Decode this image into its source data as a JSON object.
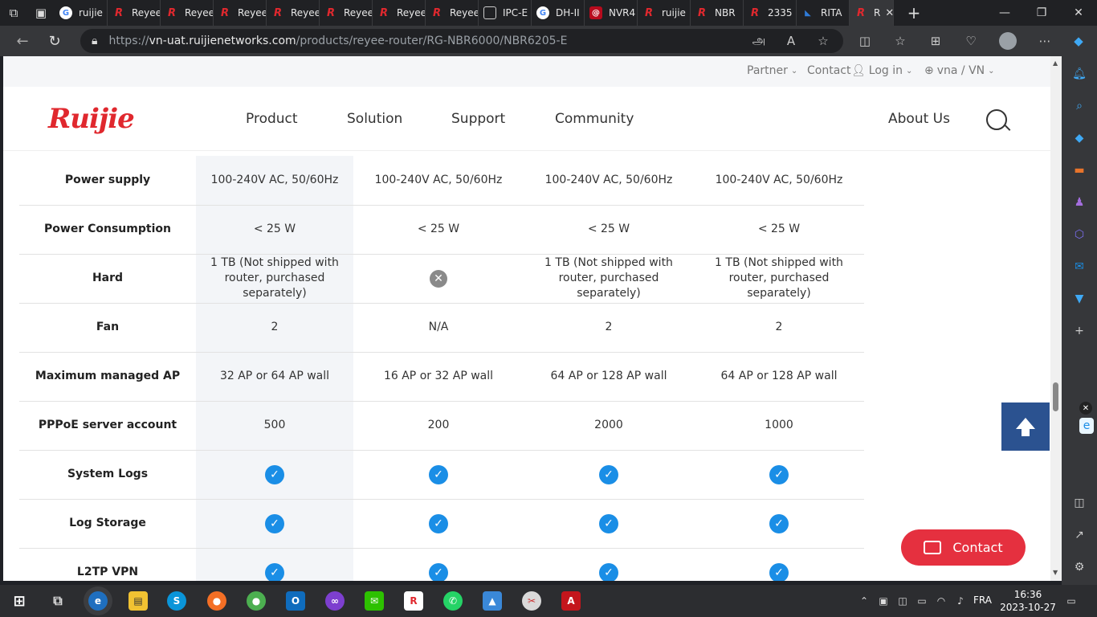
{
  "browser": {
    "tabs": [
      {
        "label": "ruijie",
        "fav": "G"
      },
      {
        "label": "Reyee",
        "fav": "R"
      },
      {
        "label": "Reyee",
        "fav": "R"
      },
      {
        "label": "Reyee",
        "fav": "R"
      },
      {
        "label": "Reyee",
        "fav": "R"
      },
      {
        "label": "Reyee",
        "fav": "R"
      },
      {
        "label": "Reyee",
        "fav": "R"
      },
      {
        "label": "Reyee",
        "fav": "R"
      },
      {
        "label": "IPC-E",
        "fav": "D"
      },
      {
        "label": "DH-II",
        "fav": "G"
      },
      {
        "label": "NVR4",
        "fav": "N"
      },
      {
        "label": "ruijie",
        "fav": "R"
      },
      {
        "label": "NBR",
        "fav": "R"
      },
      {
        "label": "2335",
        "fav": "R"
      },
      {
        "label": "RITA",
        "fav": "T"
      },
      {
        "label": "R",
        "fav": "R"
      }
    ],
    "url_scheme": "https://",
    "url_host": "vn-uat.ruijienetworks.com",
    "url_path": "/products/reyee-router/RG-NBR6000/NBR6205-E"
  },
  "site": {
    "topnav": {
      "partner": "Partner",
      "contact": "Contact",
      "login": "Log in",
      "region": "vna / VN"
    },
    "logo": "Ruijie",
    "menu": {
      "product": "Product",
      "solution": "Solution",
      "support": "Support",
      "community": "Community",
      "about": "About Us"
    },
    "rows": [
      {
        "label": "Power supply",
        "cells": [
          "100-240V AC, 50/60Hz",
          "100-240V AC, 50/60Hz",
          "100-240V AC, 50/60Hz",
          "100-240V AC, 50/60Hz"
        ]
      },
      {
        "label": "Power Consumption",
        "cells": [
          "< 25 W",
          "< 25 W",
          "< 25 W",
          "< 25 W"
        ]
      },
      {
        "label": "Hard",
        "cells": [
          "1 TB (Not shipped with router, purchased separately)",
          "__NO__",
          "1 TB (Not shipped with router, purchased separately)",
          "1 TB (Not shipped with router, purchased separately)"
        ]
      },
      {
        "label": "Fan",
        "cells": [
          "2",
          "N/A",
          "2",
          "2"
        ]
      },
      {
        "label": "Maximum managed AP",
        "cells": [
          "32 AP or 64 AP wall",
          "16 AP or 32 AP wall",
          "64 AP or 128 AP wall",
          "64 AP or 128 AP wall"
        ]
      },
      {
        "label": "PPPoE server account",
        "cells": [
          "500",
          "200",
          "2000",
          "1000"
        ]
      },
      {
        "label": "System Logs",
        "cells": [
          "__YES__",
          "__YES__",
          "__YES__",
          "__YES__"
        ]
      },
      {
        "label": "Log Storage",
        "cells": [
          "__YES__",
          "__YES__",
          "__YES__",
          "__YES__"
        ]
      },
      {
        "label": "L2TP VPN",
        "cells": [
          "__YES__",
          "__YES__",
          "__YES__",
          "__YES__"
        ]
      }
    ],
    "contact_button": "Contact"
  },
  "taskbar": {
    "lang": "FRA",
    "time": "16:36",
    "date": "2023-10-27"
  },
  "colors": {
    "brand_red": "#e0282e",
    "check_blue": "#1a8ee6",
    "contact_red": "#e5303f",
    "top_button": "#2b5290"
  }
}
